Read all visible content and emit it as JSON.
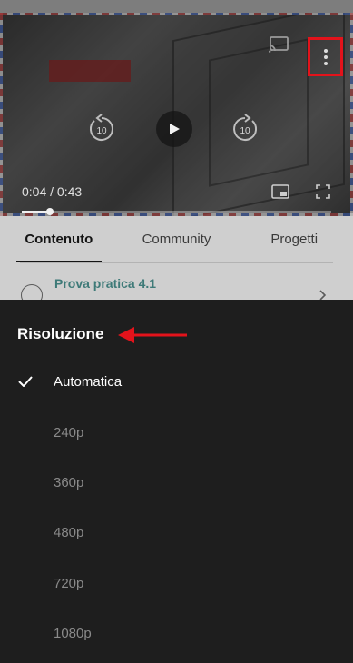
{
  "player": {
    "current_time": "0:04",
    "duration": "0:43",
    "time_display": "0:04 / 0:43",
    "progress_fraction": 0.09,
    "rewind_seconds": "10",
    "forward_seconds": "10"
  },
  "tabs": [
    {
      "label": "Contenuto",
      "active": true
    },
    {
      "label": "Community",
      "active": false
    },
    {
      "label": "Progetti",
      "active": false
    }
  ],
  "lesson": {
    "title": "Prova pratica 4.1"
  },
  "sheet": {
    "title": "Risoluzione",
    "options": [
      {
        "label": "Automatica",
        "selected": true
      },
      {
        "label": "240p",
        "selected": false
      },
      {
        "label": "360p",
        "selected": false
      },
      {
        "label": "480p",
        "selected": false
      },
      {
        "label": "720p",
        "selected": false
      },
      {
        "label": "1080p",
        "selected": false
      }
    ]
  },
  "colors": {
    "sheet_background": "#1e1e1e",
    "annotation_red": "#e3131b",
    "lesson_link": "#3e7a78",
    "option_inactive": "#8a8a8a"
  },
  "icons": [
    "cast-icon",
    "more-vert-icon",
    "rewind-10-icon",
    "play-icon",
    "forward-10-icon",
    "pip-icon",
    "fullscreen-icon",
    "check-icon",
    "chevron-right-icon"
  ]
}
